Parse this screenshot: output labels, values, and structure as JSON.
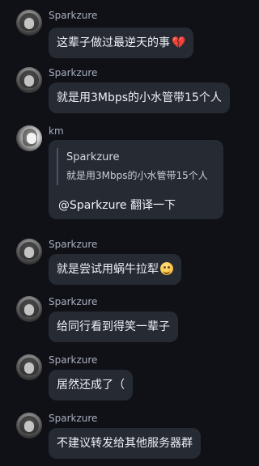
{
  "messages": [
    {
      "author": "Sparkzure",
      "text": "这辈子做过最逆天的事",
      "emoji": "broken-heart"
    },
    {
      "author": "Sparkzure",
      "text": "就是用3Mbps的小水管带15个人"
    },
    {
      "author": "km",
      "quote": {
        "author": "Sparkzure",
        "text": "就是用3Mbps的小水管带15个人"
      },
      "text": "@Sparkzure 翻译一下"
    },
    {
      "author": "Sparkzure",
      "text": "就是尝试用蜗牛拉犁",
      "emoji": "smiling-face"
    },
    {
      "author": "Sparkzure",
      "text": "给同行看到得笑一辈子"
    },
    {
      "author": "Sparkzure",
      "text": "居然还成了（"
    },
    {
      "author": "Sparkzure",
      "text": "不建议转发给其他服务器群"
    }
  ]
}
